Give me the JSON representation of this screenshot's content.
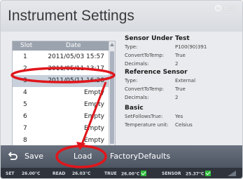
{
  "window": {
    "title": "Instrument Settings",
    "clock": "16:35"
  },
  "slot_list": {
    "headers": {
      "slot": "Slot",
      "date": "Date"
    },
    "rows": [
      {
        "slot": "1",
        "date": "2011/05/03 15:57",
        "selected": false
      },
      {
        "slot": "2",
        "date": "2011/05/11 13:17",
        "selected": false
      },
      {
        "slot": "3",
        "date": "2011/05/11 16:28",
        "selected": true
      },
      {
        "slot": "4",
        "date": "Empty",
        "selected": false
      },
      {
        "slot": "5",
        "date": "Empty",
        "selected": false
      },
      {
        "slot": "6",
        "date": "Empty",
        "selected": false
      },
      {
        "slot": "7",
        "date": "Empty",
        "selected": false
      },
      {
        "slot": "8",
        "date": "Empty",
        "selected": false
      }
    ]
  },
  "details": {
    "sensor_under_test": {
      "title": "Sensor Under Test",
      "type_label": "Type:",
      "type_value": "P100(90)391",
      "convert_label": "ConvertToTemp:",
      "convert_value": "True",
      "decimals_label": "Decimals:",
      "decimals_value": "2"
    },
    "reference_sensor": {
      "title": "Reference Sensor",
      "type_label": "Type:",
      "type_value": "External",
      "convert_label": "ConvertToTemp:",
      "convert_value": "True",
      "decimals_label": "Decimals:",
      "decimals_value": "2"
    },
    "basic": {
      "title": "Basic",
      "setfollows_label": "SetFollowsTrue:",
      "setfollows_value": "Yes",
      "unit_label": "Temperature unit:",
      "unit_value": "Celsius"
    }
  },
  "toolbar": {
    "back_icon": "back-arrow-icon",
    "save_label": "Save",
    "load_label": "Load",
    "factory_label": "FactoryDefaults"
  },
  "status_bar": {
    "set_label": "SET",
    "set_value": "26.00°C",
    "read_label": "READ",
    "read_value": "26.03°C",
    "true_label": "TRUE",
    "true_value": "26.00°C",
    "sensor_label": "SENSOR",
    "sensor_value": "25.37°C"
  },
  "colors": {
    "annotation": "#e0161c",
    "selection": "#c7d0db",
    "toolbar": "#555d69"
  }
}
